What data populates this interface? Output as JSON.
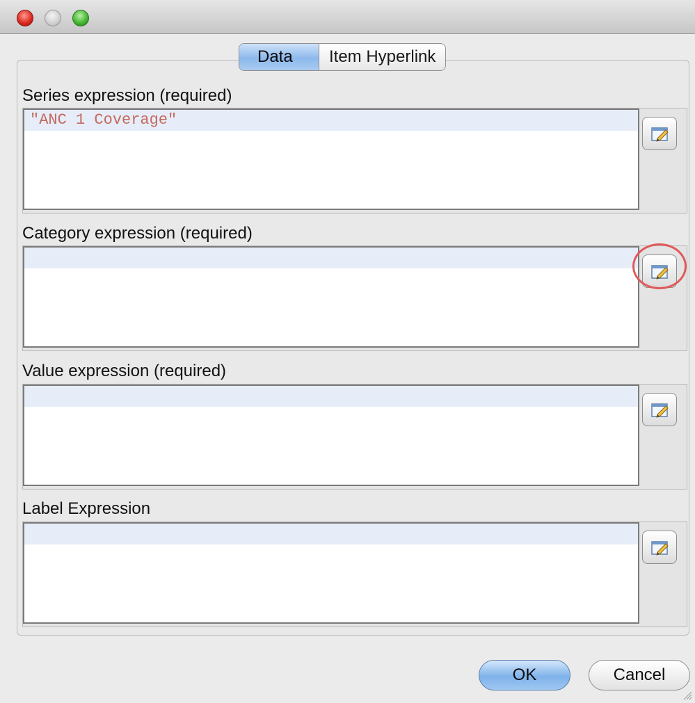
{
  "window": {
    "title": ""
  },
  "tabs": [
    {
      "label": "Data",
      "active": true
    },
    {
      "label": "Item Hyperlink",
      "active": false
    }
  ],
  "sections": {
    "series": {
      "label": "Series expression (required)",
      "value": "\"ANC 1 Coverage\""
    },
    "category": {
      "label": "Category expression (required)",
      "value": ""
    },
    "value": {
      "label": "Value expression (required)",
      "value": ""
    },
    "label": {
      "label": "Label Expression",
      "value": ""
    }
  },
  "buttons": {
    "ok_label": "OK",
    "cancel_label": "Cancel"
  },
  "colors": {
    "accent_blue": "#8cb9ec",
    "highlight_ring": "#e05a5a",
    "expression_text": "#c46a5e"
  },
  "icons": {
    "edit_expression": "pencil-edit-icon"
  }
}
